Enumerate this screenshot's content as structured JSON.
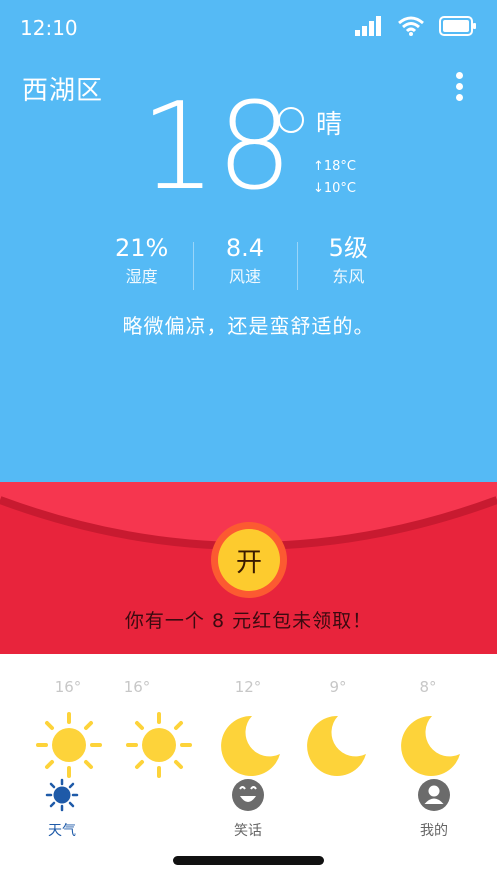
{
  "status": {
    "time": "12:10"
  },
  "location": "西湖区",
  "current": {
    "temperature": "18",
    "condition": "晴",
    "high": "↑18°C",
    "low": "↓10°C"
  },
  "stats": [
    {
      "value": "21%",
      "label": "湿度"
    },
    {
      "value": "8.4",
      "label": "风速"
    },
    {
      "value": "5级",
      "label": "东风"
    }
  ],
  "comment": "略微偏凉，还是蛮舒适的。",
  "red_packet": {
    "button_label": "开",
    "message": "你有一个 8 元红包未领取！"
  },
  "forecast": [
    {
      "temp": "16°",
      "icon": "sun-icon"
    },
    {
      "temp": "16°",
      "icon": "sun-icon"
    },
    {
      "temp": "12°",
      "icon": "moon-icon"
    },
    {
      "temp": "9°",
      "icon": "moon-icon"
    },
    {
      "temp": "8°",
      "icon": "moon-icon"
    }
  ],
  "tabs": [
    {
      "label": "天气",
      "icon": "sun-tab-icon",
      "active": true
    },
    {
      "label": "笑话",
      "icon": "smiley-icon",
      "active": false
    },
    {
      "label": "我的",
      "icon": "user-icon",
      "active": false
    }
  ],
  "colors": {
    "sky": "#55baf5",
    "packet_red": "#e8243c",
    "accent_blue": "#1e5aa8",
    "sun_yellow": "#fdd33a"
  }
}
